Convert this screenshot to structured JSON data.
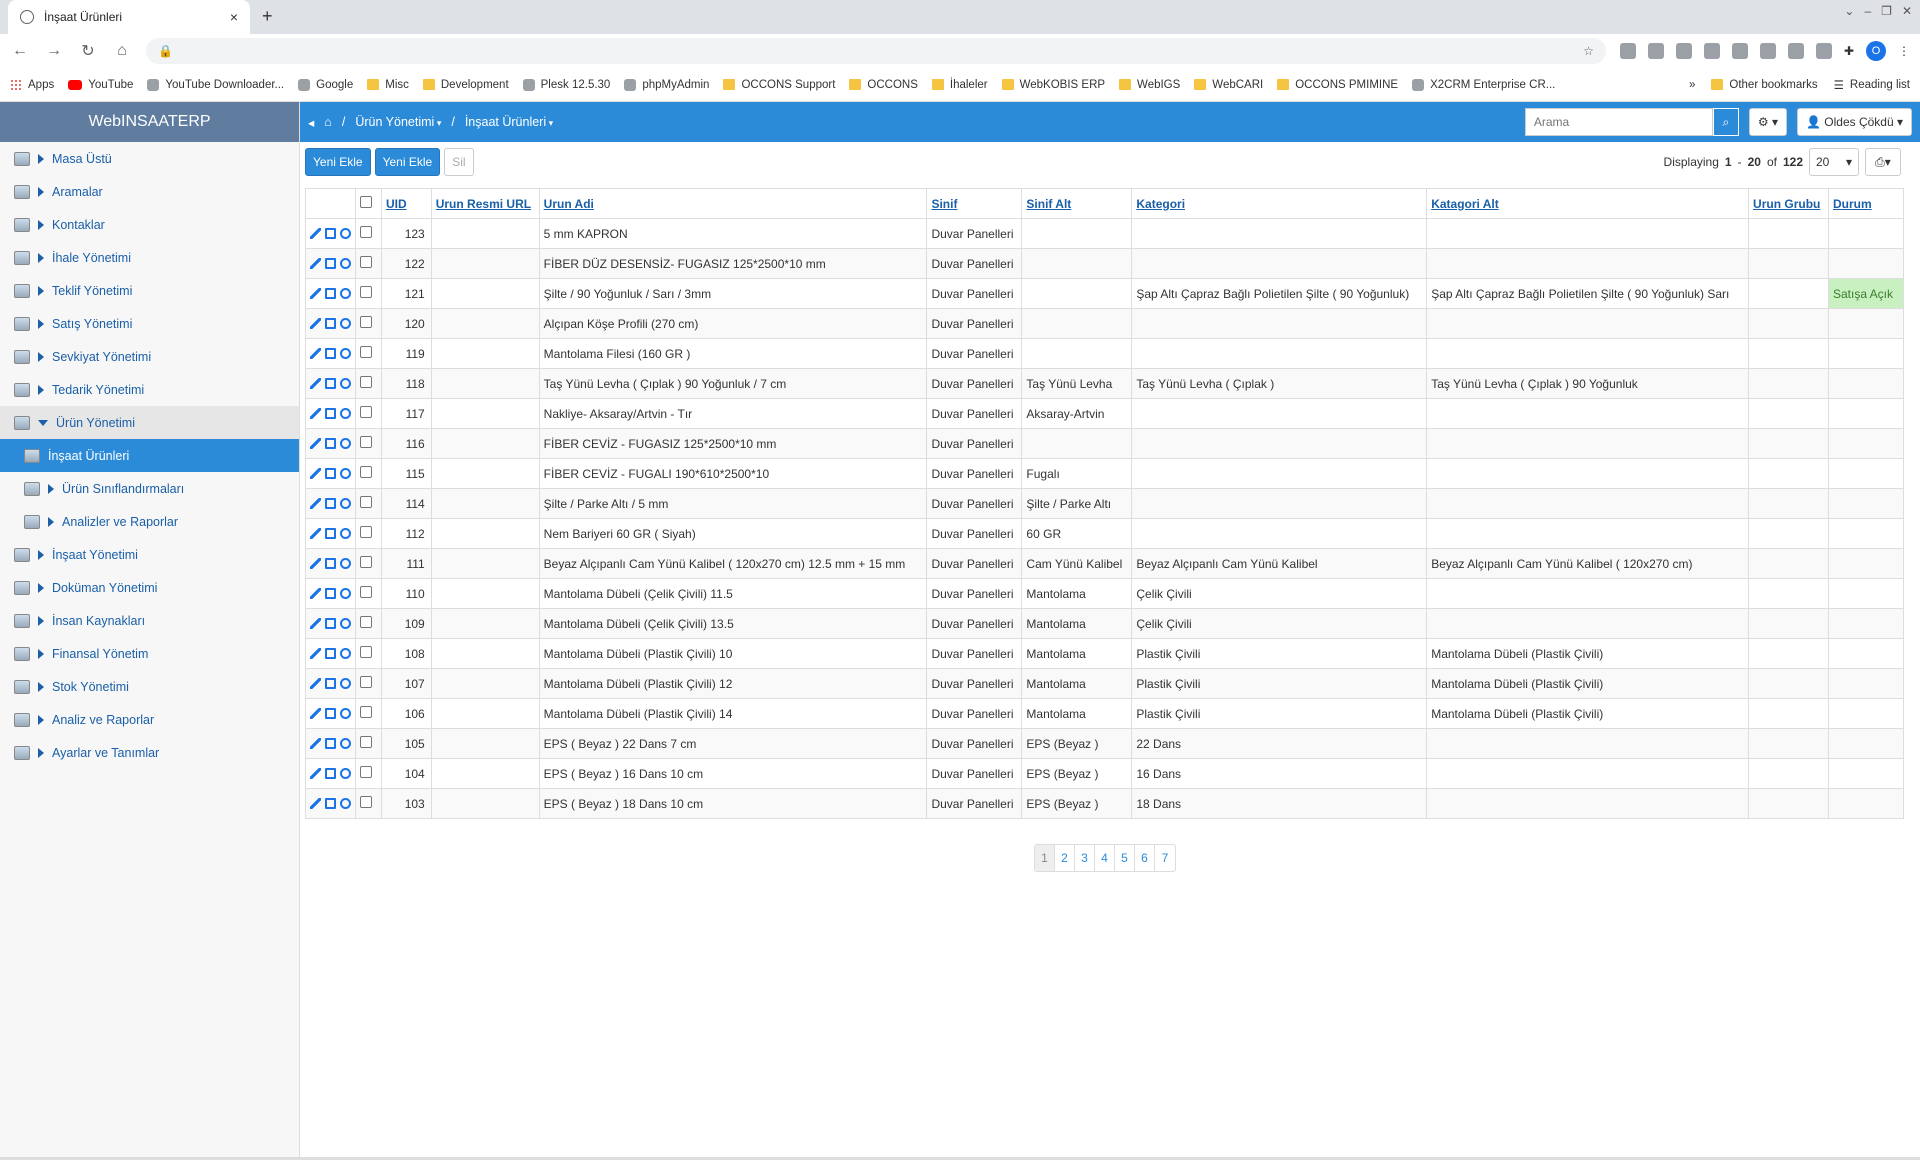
{
  "browser": {
    "tab_title": "İnşaat Ürünleri",
    "tab_close": "×",
    "new_tab": "+",
    "bookmarks": [
      {
        "label": "Apps",
        "icon": "apps-icon"
      },
      {
        "label": "YouTube",
        "icon": "youtube-icon"
      },
      {
        "label": "YouTube Downloader...",
        "icon": "download-icon"
      },
      {
        "label": "Google",
        "icon": "google-icon"
      },
      {
        "label": "Misc",
        "icon": "folder-icon"
      },
      {
        "label": "Development",
        "icon": "folder-icon"
      },
      {
        "label": "Plesk 12.5.30",
        "icon": "plesk-icon"
      },
      {
        "label": "phpMyAdmin",
        "icon": "globe-icon"
      },
      {
        "label": "OCCONS Support",
        "icon": "folder-icon"
      },
      {
        "label": "OCCONS",
        "icon": "folder-icon"
      },
      {
        "label": "İhaleler",
        "icon": "folder-icon"
      },
      {
        "label": "WebKOBIS ERP",
        "icon": "folder-icon"
      },
      {
        "label": "WebIGS",
        "icon": "folder-icon"
      },
      {
        "label": "WebCARI",
        "icon": "folder-icon"
      },
      {
        "label": "OCCONS PMIMINE",
        "icon": "folder-icon"
      },
      {
        "label": "X2CRM Enterprise CR...",
        "icon": "x2crm-icon"
      }
    ],
    "more": "»",
    "other_bookmarks": "Other bookmarks",
    "reading_list": "Reading list",
    "profile_initial": "O"
  },
  "sidebar": {
    "brand": "WebINSAATERP",
    "items": [
      {
        "label": "Masa Üstü",
        "state": "closed"
      },
      {
        "label": "Aramalar",
        "state": "closed"
      },
      {
        "label": "Kontaklar",
        "state": "closed"
      },
      {
        "label": "İhale Yönetimi",
        "state": "closed"
      },
      {
        "label": "Teklif Yönetimi",
        "state": "closed"
      },
      {
        "label": "Satış Yönetimi",
        "state": "closed"
      },
      {
        "label": "Sevkiyat Yönetimi",
        "state": "closed"
      },
      {
        "label": "Tedarik Yönetimi",
        "state": "closed"
      },
      {
        "label": "Ürün Yönetimi",
        "state": "open"
      },
      {
        "label": "İnşaat Ürünleri",
        "state": "active"
      },
      {
        "label": "Ürün Sınıflandırmaları",
        "state": "sub"
      },
      {
        "label": "Analizler ve Raporlar",
        "state": "sub"
      },
      {
        "label": "İnşaat Yönetimi",
        "state": "closed"
      },
      {
        "label": "Doküman Yönetimi",
        "state": "closed"
      },
      {
        "label": "İnsan Kaynakları",
        "state": "closed"
      },
      {
        "label": "Finansal Yönetim",
        "state": "closed"
      },
      {
        "label": "Stok Yönetimi",
        "state": "closed"
      },
      {
        "label": "Analiz ve Raporlar",
        "state": "closed"
      },
      {
        "label": "Ayarlar ve Tanımlar",
        "state": "closed"
      }
    ]
  },
  "topbar": {
    "crumb_sep": "/",
    "crumb1": "Ürün Yönetimi",
    "crumb2": "İnşaat Ürünleri",
    "search_placeholder": "Arama",
    "user": "Oldes Çökdü"
  },
  "toolbar": {
    "add1": "Yeni Ekle",
    "add2": "Yeni Ekle",
    "delete": "Sil",
    "displaying_prefix": "Displaying",
    "range_from": "1",
    "range_sep": "-",
    "range_to": "20",
    "of": "of",
    "total": "122",
    "page_size": "20"
  },
  "table": {
    "headers": [
      "UID",
      "Urun Resmi URL",
      "Urun Adi",
      "Sinif",
      "Sinif Alt",
      "Kategori",
      "Katagori Alt",
      "Urun Grubu",
      "Durum"
    ],
    "rows": [
      [
        "123",
        "",
        "5 mm KAPRON",
        "Duvar Panelleri",
        "",
        "",
        "",
        "",
        ""
      ],
      [
        "122",
        "",
        "FİBER DÜZ DESENSİZ- FUGASIZ 125*2500*10 mm",
        "Duvar Panelleri",
        "",
        "",
        "",
        "",
        ""
      ],
      [
        "121",
        "",
        "Şilte / 90 Yoğunluk / Sarı / 3mm",
        "Duvar Panelleri",
        "",
        "Şap Altı Çapraz Bağlı Polietilen Şilte ( 90 Yoğunluk)",
        "Şap Altı Çapraz Bağlı Polietilen Şilte ( 90 Yoğunluk) Sarı",
        "",
        "Satışa Açık"
      ],
      [
        "120",
        "",
        "Alçıpan Köşe Profili (270 cm)",
        "Duvar Panelleri",
        "",
        "",
        "",
        "",
        ""
      ],
      [
        "119",
        "",
        "Mantolama Filesi (160 GR )",
        "Duvar Panelleri",
        "",
        "",
        "",
        "",
        ""
      ],
      [
        "118",
        "",
        "Taş Yünü Levha ( Çıplak ) 90 Yoğunluk / 7 cm",
        "Duvar Panelleri",
        "Taş Yünü Levha",
        "Taş Yünü Levha ( Çıplak )",
        "Taş Yünü Levha ( Çıplak ) 90 Yoğunluk",
        "",
        ""
      ],
      [
        "117",
        "",
        "Nakliye- Aksaray/Artvin - Tır",
        "Duvar Panelleri",
        "Aksaray-Artvin",
        "",
        "",
        "",
        ""
      ],
      [
        "116",
        "",
        "FİBER CEVİZ - FUGASIZ 125*2500*10 mm",
        "Duvar Panelleri",
        "",
        "",
        "",
        "",
        ""
      ],
      [
        "115",
        "",
        "FİBER CEVİZ - FUGALI 190*610*2500*10",
        "Duvar Panelleri",
        "Fugalı",
        "",
        "",
        "",
        ""
      ],
      [
        "114",
        "",
        "Şilte / Parke Altı / 5 mm",
        "Duvar Panelleri",
        "Şilte / Parke Altı",
        "",
        "",
        "",
        ""
      ],
      [
        "112",
        "",
        "Nem Bariyeri 60 GR ( Siyah)",
        "Duvar Panelleri",
        "60 GR",
        "",
        "",
        "",
        ""
      ],
      [
        "111",
        "",
        "Beyaz Alçıpanlı Cam Yünü Kalibel ( 120x270 cm) 12.5 mm + 15 mm",
        "Duvar Panelleri",
        "Cam Yünü Kalibel",
        "Beyaz Alçıpanlı Cam Yünü Kalibel",
        "Beyaz Alçıpanlı Cam Yünü Kalibel ( 120x270 cm)",
        "",
        ""
      ],
      [
        "110",
        "",
        "Mantolama Dübeli (Çelik Çivili) 11.5",
        "Duvar Panelleri",
        "Mantolama",
        "Çelik Çivili",
        "",
        "",
        ""
      ],
      [
        "109",
        "",
        "Mantolama Dübeli (Çelik Çivili) 13.5",
        "Duvar Panelleri",
        "Mantolama",
        "Çelik Çivili",
        "",
        "",
        ""
      ],
      [
        "108",
        "",
        "Mantolama Dübeli (Plastik Çivili) 10",
        "Duvar Panelleri",
        "Mantolama",
        "Plastik Çivili",
        "Mantolama Dübeli (Plastik Çivili)",
        "",
        ""
      ],
      [
        "107",
        "",
        "Mantolama Dübeli (Plastik Çivili) 12",
        "Duvar Panelleri",
        "Mantolama",
        "Plastik Çivili",
        "Mantolama Dübeli (Plastik Çivili)",
        "",
        ""
      ],
      [
        "106",
        "",
        "Mantolama Dübeli (Plastik Çivili) 14",
        "Duvar Panelleri",
        "Mantolama",
        "Plastik Çivili",
        "Mantolama Dübeli (Plastik Çivili)",
        "",
        ""
      ],
      [
        "105",
        "",
        "EPS ( Beyaz ) 22 Dans 7 cm",
        "Duvar Panelleri",
        "EPS (Beyaz )",
        "22 Dans",
        "",
        "",
        ""
      ],
      [
        "104",
        "",
        "EPS ( Beyaz ) 16 Dans 10 cm",
        "Duvar Panelleri",
        "EPS (Beyaz )",
        "16 Dans",
        "",
        "",
        ""
      ],
      [
        "103",
        "",
        "EPS ( Beyaz ) 18 Dans 10 cm",
        "Duvar Panelleri",
        "EPS (Beyaz )",
        "18 Dans",
        "",
        "",
        ""
      ]
    ]
  },
  "pager": [
    "1",
    "2",
    "3",
    "4",
    "5",
    "6",
    "7"
  ],
  "colors": {
    "accent": "#2b8bd9",
    "brand_bg": "#607d9f",
    "status_green": "#c9f0c0"
  }
}
